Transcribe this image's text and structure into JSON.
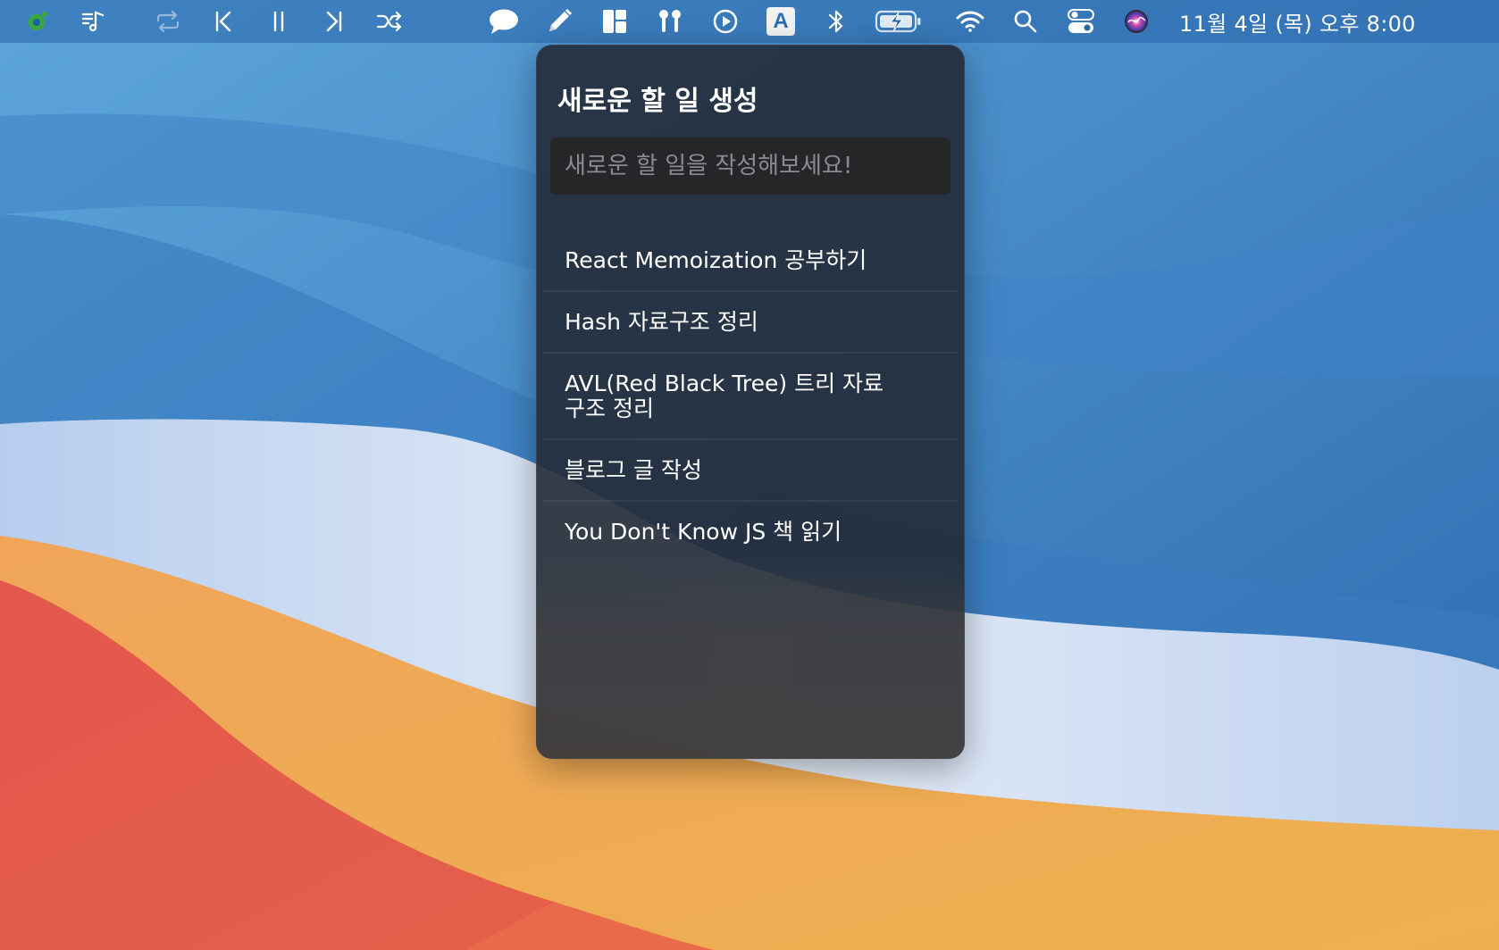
{
  "menubar": {
    "icons": [
      "app-status-icon",
      "music-note-icon",
      "repeat-icon",
      "previous-track-icon",
      "pause-icon",
      "next-track-icon",
      "shuffle-icon",
      "chat-bubble-icon",
      "pencil-icon",
      "layout-icon",
      "airpods-icon",
      "play-circle-icon",
      "input-source-icon",
      "bluetooth-icon",
      "battery-charging-icon",
      "wifi-icon",
      "spotlight-search-icon",
      "control-center-icon",
      "siri-icon"
    ],
    "input_source_letter": "A",
    "clock": "11월 4일 (목) 오후 8:00"
  },
  "popover": {
    "title": "새로운 할 일 생성",
    "input_placeholder": "새로운 할 일을 작성해보세요!",
    "input_value": "",
    "todos": [
      {
        "text": "React Memoization 공부하기"
      },
      {
        "text": "Hash 자료구조 정리"
      },
      {
        "text": "AVL(Red Black Tree) 트리 자료 구조 정리"
      },
      {
        "text": "블로그 글 작성"
      },
      {
        "text": "You Don't Know JS 책 읽기"
      }
    ]
  },
  "colors": {
    "popover_bg": "#222a36",
    "input_bg": "#242628",
    "placeholder": "#8a8c8f",
    "wallpaper_blue": "#2f6fb3",
    "wallpaper_orange": "#eea04c",
    "wallpaper_red": "#e4604e"
  }
}
